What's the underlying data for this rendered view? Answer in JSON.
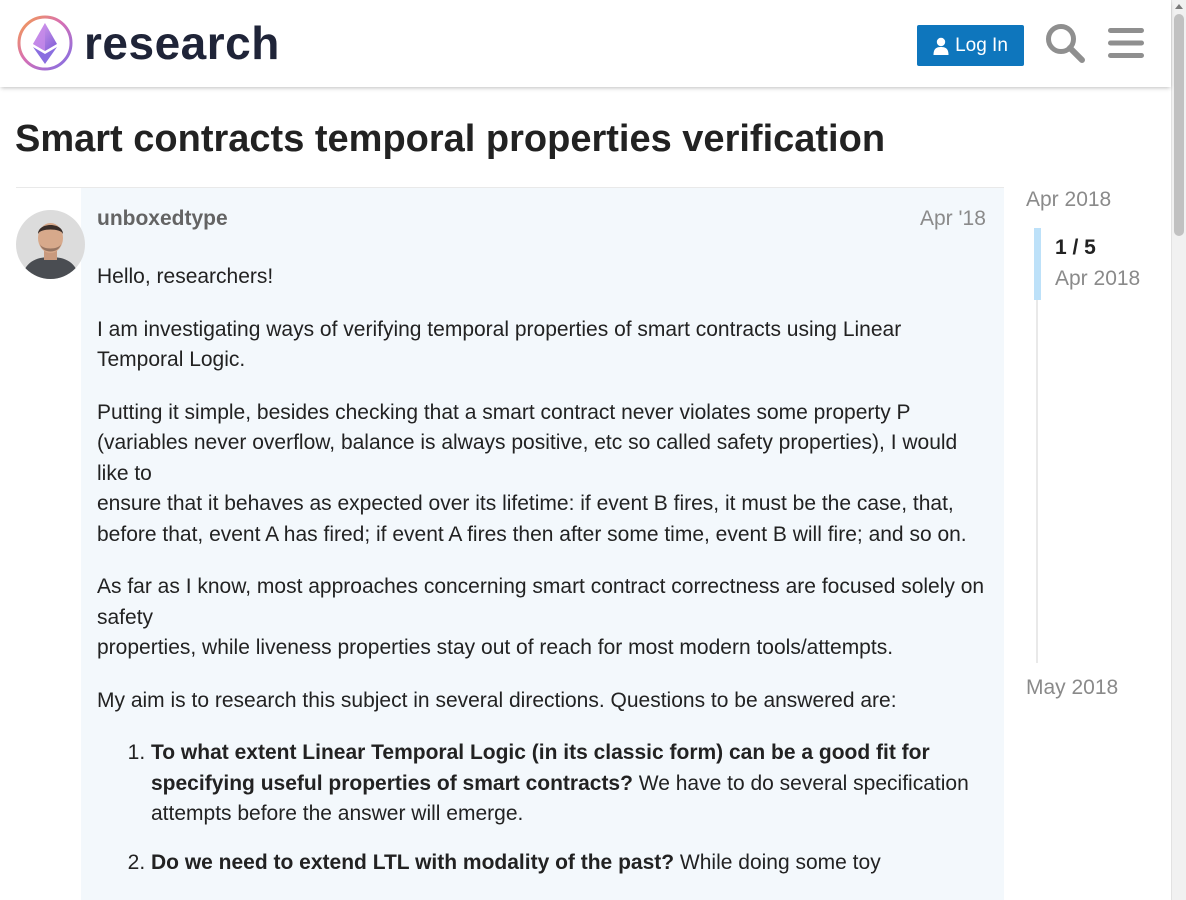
{
  "header": {
    "logo_text": "research",
    "login_label": "Log In",
    "accent_color": "#0e76bd"
  },
  "topic": {
    "title": "Smart contracts temporal properties verification"
  },
  "post": {
    "username": "unboxedtype",
    "date": "Apr '18",
    "paragraphs": [
      "Hello, researchers!",
      "I am investigating ways of verifying temporal properties of smart contracts using Linear Temporal Logic.",
      "Putting it simple, besides checking that a smart contract never violates some property P (variables never overflow, balance is always positive, etc so called safety properties), I would like to",
      "ensure that it behaves as expected over its lifetime: if event B fires, it must be the case, that, before that, event A has fired; if event A fires then after some time, event B will fire; and so on.",
      "As far as I know, most approaches concerning smart contract correctness are focused solely on safety",
      "properties, while liveness properties stay out of reach for most modern tools/attempts.",
      "My aim is to research this subject in several directions. Questions to be answered are:"
    ],
    "list_items": [
      {
        "bold": "To what extent Linear Temporal Logic (in its classic form) can be a good fit for specifying useful properties of smart contracts?",
        "text": " We have to do several specification attempts before the answer will emerge."
      },
      {
        "bold": "Do we need to extend LTL with modality of the past?",
        "text": " While doing some toy"
      }
    ]
  },
  "timeline": {
    "start_date": "Apr 2018",
    "position": "1 / 5",
    "position_date": "Apr 2018",
    "end_date": "May 2018"
  }
}
